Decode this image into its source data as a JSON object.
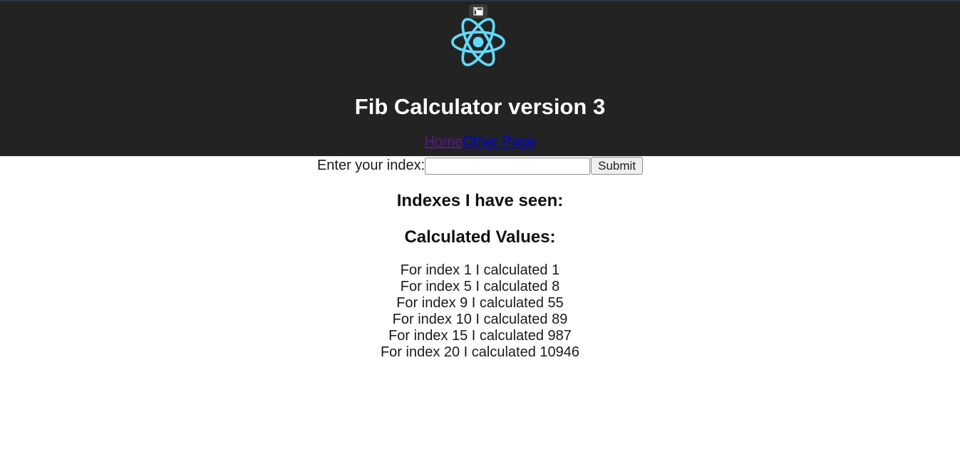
{
  "header": {
    "title": "Fib Calculator version 3",
    "logo_icon": "react-atom-logo",
    "logo_color": "#61dafb",
    "background": "#232323",
    "restore_icon": "restore-window-icon"
  },
  "nav": {
    "home_label": "Home",
    "other_label": "Other Page"
  },
  "form": {
    "label": "Enter your index:",
    "input_value": "",
    "submit_label": "Submit"
  },
  "indexes_heading": "Indexes I have seen:",
  "values_heading": "Calculated Values:",
  "values": [
    "For index 1 I calculated 1",
    "For index 5 I calculated 8",
    "For index 9 I calculated 55",
    "For index 10 I calculated 89",
    "For index 15 I calculated 987",
    "For index 20 I calculated 10946"
  ]
}
